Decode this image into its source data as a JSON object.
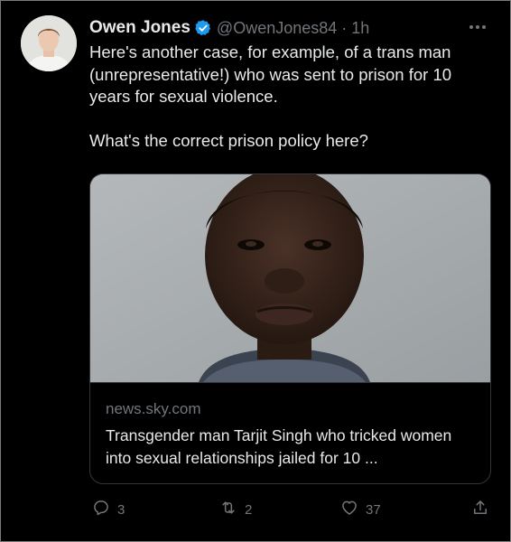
{
  "tweet": {
    "author_name": "Owen Jones",
    "verified": true,
    "handle": "@OwenJones84",
    "separator": "·",
    "time": "1h",
    "text_paragraph_1": "Here's another case, for example, of a trans man (unrepresentative!) who was sent to prison for 10 years for sexual violence.",
    "text_paragraph_2": "What's the correct prison policy here?"
  },
  "link_card": {
    "domain": "news.sky.com",
    "title": "Transgender man Tarjit Singh who tricked women into sexual relationships jailed for 10 ..."
  },
  "actions": {
    "replies": "3",
    "retweets": "2",
    "likes": "37"
  },
  "icons": {
    "reply": "reply-icon",
    "retweet": "retweet-icon",
    "like": "heart-icon",
    "share": "share-icon",
    "more": "more-icon",
    "verified": "verified-badge-icon"
  },
  "colors": {
    "background": "#000000",
    "primary_text": "#e7e9ea",
    "secondary_text": "#71767b",
    "verified_blue": "#1d9bf0",
    "card_border": "#333639"
  }
}
